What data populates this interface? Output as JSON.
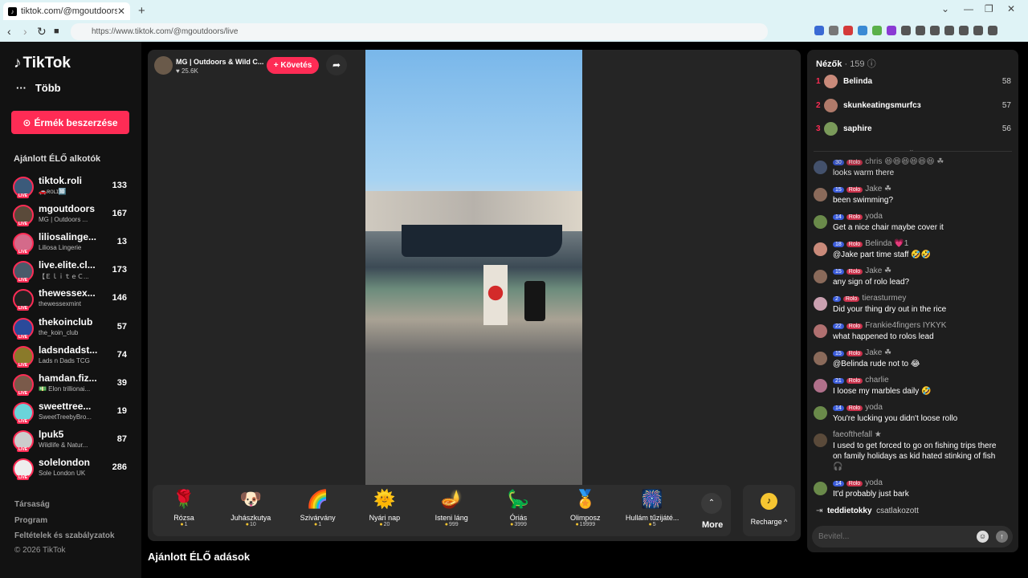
{
  "browser": {
    "tab_title": "tiktok.com/@mgoutdoors/live",
    "url": "https://www.tiktok.com/@mgoutdoors/live"
  },
  "sidebar": {
    "brand": "TikTok",
    "more": "Több",
    "coins_button": "Érmék beszerzése",
    "section_title": "Ajánlott ÉLŐ alkotók",
    "channels": [
      {
        "name": "tiktok.roli",
        "sub": "🚗ʀᴏʟɪ🔟",
        "count": "133",
        "color": "#3b5a7a"
      },
      {
        "name": "mgoutdoors",
        "sub": "MG | Outdoors ...",
        "count": "167",
        "color": "#5a4a3a"
      },
      {
        "name": "liliosalinge...",
        "sub": "Liliosa Lingerie",
        "count": "13",
        "color": "#d46a8a"
      },
      {
        "name": "live.elite.cl...",
        "sub": "【ＥｌｉｔｅＣ...",
        "count": "173",
        "color": "#4a5a6a"
      },
      {
        "name": "thewessex...",
        "sub": "thewessexmint",
        "count": "146",
        "color": "#222222"
      },
      {
        "name": "thekoinclub",
        "sub": "the_koin_club",
        "count": "57",
        "color": "#2a4a9a"
      },
      {
        "name": "ladsndadst...",
        "sub": "Lads n Dads TCG",
        "count": "74",
        "color": "#8a7a2a"
      },
      {
        "name": "hamdan.fiz...",
        "sub": "💵 Elon trillionai...",
        "count": "39",
        "color": "#7a5a4a"
      },
      {
        "name": "sweettree...",
        "sub": "SweetTreebyBro...",
        "count": "19",
        "color": "#6ad4da"
      },
      {
        "name": "lpuk5",
        "sub": "Wildlife & Natur...",
        "count": "87",
        "color": "#cccccc"
      },
      {
        "name": "solelondon",
        "sub": "Sole London UK",
        "count": "286",
        "color": "#eeeeee"
      }
    ],
    "footer": [
      "Társaság",
      "Program",
      "Feltételek és szabályzatok",
      "© 2026 TikTok"
    ]
  },
  "stream": {
    "host_name": "MG | Outdoors & Wild C...",
    "host_likes": "♥ 25.6K",
    "follow_label": "+ Követés",
    "recommended": "Ajánlott ÉLŐ adások"
  },
  "gifts": [
    {
      "icon": "🌹",
      "name": "Rózsa",
      "price": "1"
    },
    {
      "icon": "🐶",
      "name": "Juhászkutya",
      "price": "10"
    },
    {
      "icon": "🌈",
      "name": "Szivárvány",
      "price": "1"
    },
    {
      "icon": "🌞",
      "name": "Nyári nap",
      "price": "20"
    },
    {
      "icon": "🪔",
      "name": "Isteni láng",
      "price": "999"
    },
    {
      "icon": "🦕",
      "name": "Óriás",
      "price": "3999"
    },
    {
      "icon": "🏅",
      "name": "Olimposz",
      "price": "19999"
    },
    {
      "icon": "🎆",
      "name": "Hullám tűzijáté...",
      "price": "5"
    }
  ],
  "gift_more": "More",
  "recharge": "Recharge ^",
  "viewers": {
    "title": "Nézők",
    "count": "· 159",
    "top": [
      {
        "rank": "1",
        "name": "Belinda",
        "score": "58",
        "color": "#c98a7a"
      },
      {
        "rank": "2",
        "name": "skunkeatingsmurfcз",
        "score": "57",
        "color": "#b07a6a"
      },
      {
        "rank": "3",
        "name": "saphire",
        "score": "56",
        "color": "#7a9a5a"
      }
    ]
  },
  "chat": [
    {
      "level": "30",
      "badge": "Rolo",
      "user": "chris 😆😆😆😆😆😆 ☘",
      "text": "looks warm there",
      "color": "#4a5a7a"
    },
    {
      "level": "15",
      "badge": "Rolo",
      "user": "Jake ☘",
      "text": "been swimming?",
      "color": "#8a6a5a"
    },
    {
      "level": "14",
      "badge": "Rolo",
      "user": "yoda",
      "text": "Get a nice chair maybe cover it",
      "color": "#6a8a4a"
    },
    {
      "level": "18",
      "badge": "Rolo",
      "user": "Belinda 💗1",
      "text": "@Jake part time staff 🤣🤣",
      "color": "#c98a7a"
    },
    {
      "level": "15",
      "badge": "Rolo",
      "user": "Jake ☘",
      "text": "any sign of rolo lead?",
      "color": "#8a6a5a"
    },
    {
      "level": "2",
      "badge": "Rolo",
      "user": "tierasturmey",
      "text": "Did your thing dry out in the rice",
      "color": "#caa0b0"
    },
    {
      "level": "22",
      "badge": "Rolo",
      "user": "Frankie4fingers IYKYK",
      "text": "what happened to rolos lead",
      "color": "#b07070"
    },
    {
      "level": "15",
      "badge": "Rolo",
      "user": "Jake ☘",
      "text": "@Belinda rude not to 😂",
      "color": "#8a6a5a"
    },
    {
      "level": "21",
      "badge": "Rolo",
      "user": "charlie",
      "text": "I loose my marbles daily 🤣",
      "color": "#b0708a"
    },
    {
      "level": "14",
      "badge": "Rolo",
      "user": "yoda",
      "text": "You're lucking you didn't loose rollo",
      "color": "#6a8a4a"
    },
    {
      "level": "",
      "badge": "",
      "user": "faeofthefall ★",
      "text": "I used to get forced to go on fishing trips there on family holidays as kid hated stinking of fish🎧",
      "color": "#5a4a3a"
    },
    {
      "level": "14",
      "badge": "Rolo",
      "user": "yoda",
      "text": "It'd probably just bark",
      "color": "#6a8a4a"
    }
  ],
  "join": {
    "user": "teddietokky",
    "text": "csatlakozott"
  },
  "input": {
    "placeholder": "Bevitel..."
  }
}
